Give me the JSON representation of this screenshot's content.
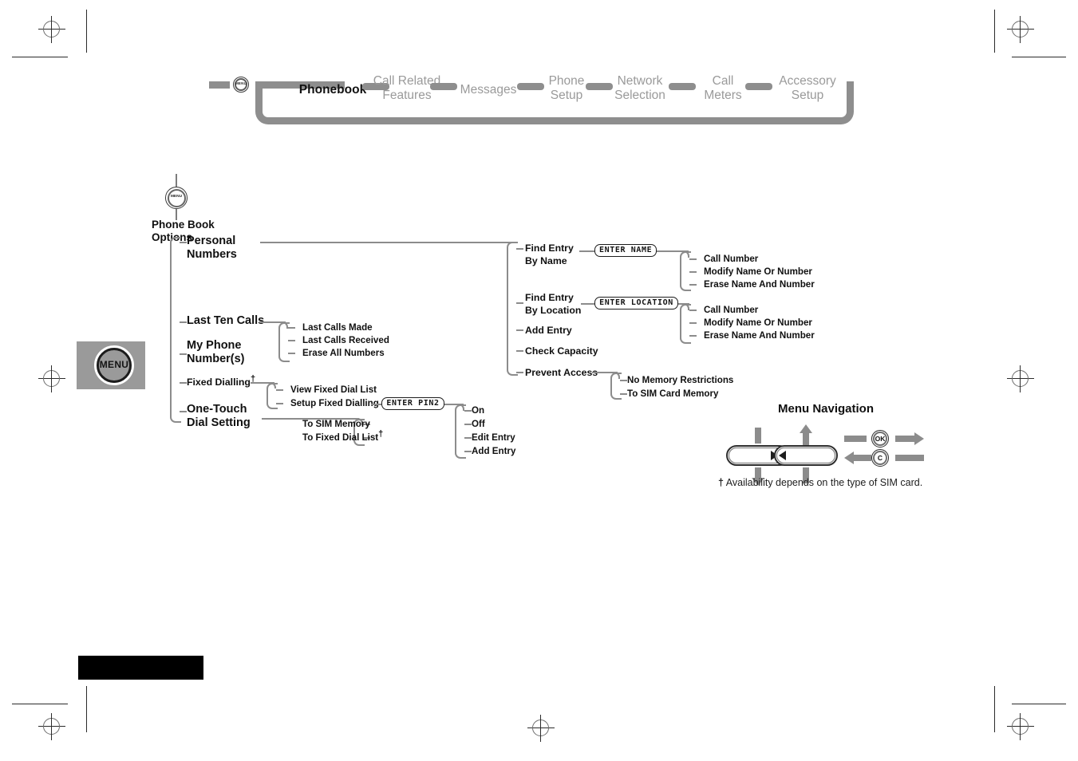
{
  "document": {
    "page_kind": "phone-manual-menu-map",
    "footer_block_label": ""
  },
  "tabstrip": {
    "menu_icon": "menu-circle-icon",
    "tabs": [
      {
        "label": "Phonebook",
        "active": true
      },
      {
        "label": "Call Related\nFeatures",
        "active": false
      },
      {
        "label": "Messages",
        "active": false
      },
      {
        "label": "Phone\nSetup",
        "active": false
      },
      {
        "label": "Network\nSelection",
        "active": false
      },
      {
        "label": "Call\nMeters",
        "active": false
      },
      {
        "label": "Accessory\nSetup",
        "active": false
      }
    ]
  },
  "menu_key": {
    "label": "MENU",
    "icon": "menu-key-icon"
  },
  "tree": {
    "root_icon": "menu-circle-icon",
    "root_label": "Phone Book\nOptions",
    "level1": [
      {
        "label": "Personal\nNumbers"
      },
      {
        "label": "Last Ten Calls"
      },
      {
        "label": "My Phone\nNumber(s)"
      },
      {
        "label": "Fixed Dialling",
        "dagger": true
      },
      {
        "label": "One-Touch\nDial Setting"
      }
    ],
    "last_ten_calls_children": [
      "Last Calls Made",
      "Last Calls Received",
      "Erase All Numbers"
    ],
    "fixed_dialling_children": [
      "View Fixed Dial List",
      "Setup Fixed Dialling"
    ],
    "one_touch_children": [
      {
        "label": "To SIM Memory",
        "dagger": false
      },
      {
        "label": "To Fixed Dial List",
        "dagger": true
      }
    ],
    "pin2_display": "ENTER PIN2",
    "pin2_children": [
      "On",
      "Off",
      "Edit Entry",
      "Add Entry"
    ],
    "personal_numbers_children": [
      "Find Entry\nBy Name",
      "Find Entry\nBy Location",
      "Add Entry",
      "Check Capacity",
      "Prevent Access"
    ],
    "enter_name_display": "ENTER NAME",
    "enter_location_display": "ENTER LOCATION",
    "find_by_name_children": [
      "Call Number",
      "Modify Name Or Number",
      "Erase Name And Number"
    ],
    "find_by_location_children": [
      "Call Number",
      "Modify Name Or Number",
      "Erase Name And Number"
    ],
    "prevent_access_children": [
      "No Memory Restrictions",
      "To SIM Card Memory"
    ]
  },
  "nav_legend": {
    "title": "Menu Navigation",
    "ok_key": "OK",
    "clear_key": "C",
    "footnote_marker": "†",
    "footnote": "Availability depends on the type of SIM card."
  },
  "colors": {
    "tab_gray": "#8e8e8e",
    "connector_gray": "#8c8c8c",
    "text_black": "#101010",
    "dim_text": "#9a9a9a",
    "menu_key_bg": "#9a9a9a"
  }
}
